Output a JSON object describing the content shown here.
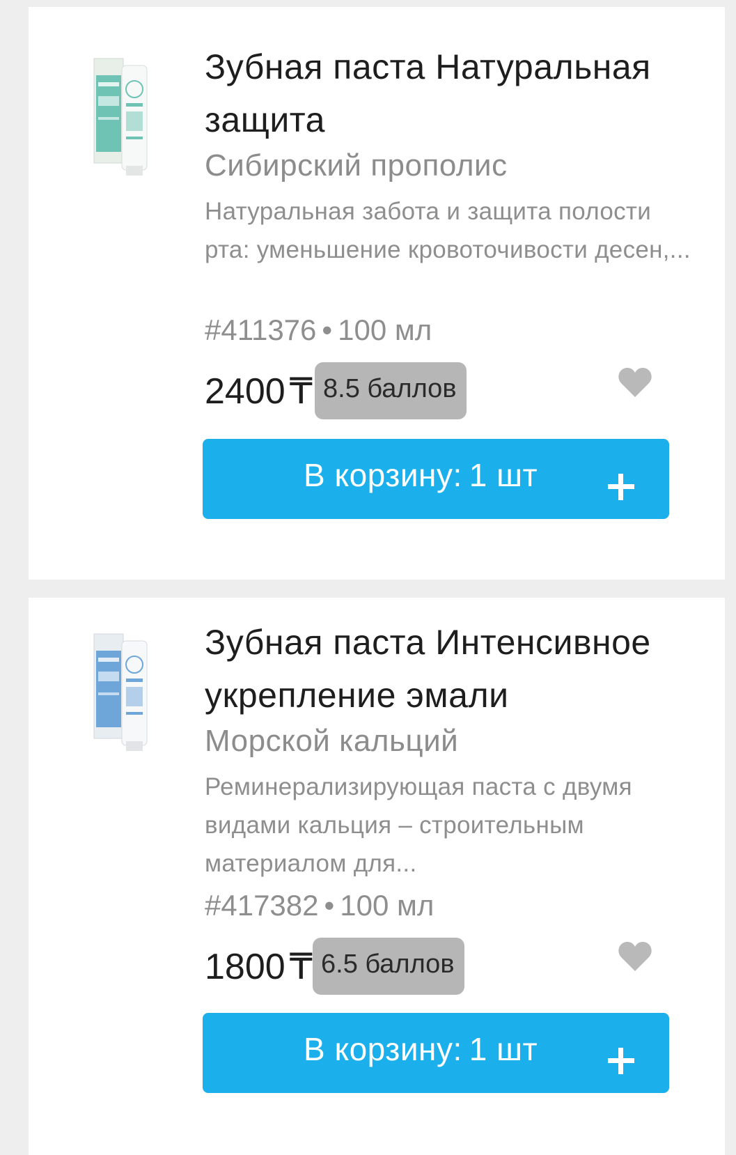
{
  "products": [
    {
      "title": "Зубная паста Натуральная защита",
      "subtitle": "Сибирский прополис",
      "description": "Натуральная забота и защита полости рта: уменьшение кровоточивости десен,...",
      "sku": "#411376",
      "volume": "100 мл",
      "price": "2400",
      "currency": "₸",
      "points": "8.5 баллов",
      "cart_label": "В корзину:",
      "cart_count": "1 шт",
      "package_color": "#6fc3b4"
    },
    {
      "title": "Зубная паста Интенсивное укрепление эмали",
      "subtitle": "Морской кальций",
      "description": "Реминерализирующая паста с двумя видами кальция – строительным материалом для...",
      "sku": "#417382",
      "volume": "100 мл",
      "price": "1800",
      "currency": "₸",
      "points": "6.5 баллов",
      "cart_label": "В корзину:",
      "cart_count": "1 шт",
      "package_color": "#6fa6da"
    }
  ],
  "separator": "•",
  "colors": {
    "accent": "#1bb0ec",
    "points_badge": "#b6b6b6",
    "heart": "#b9b9b9",
    "background": "#eeeeee"
  },
  "icons": [
    "product-image",
    "heart-icon",
    "plus-icon"
  ]
}
